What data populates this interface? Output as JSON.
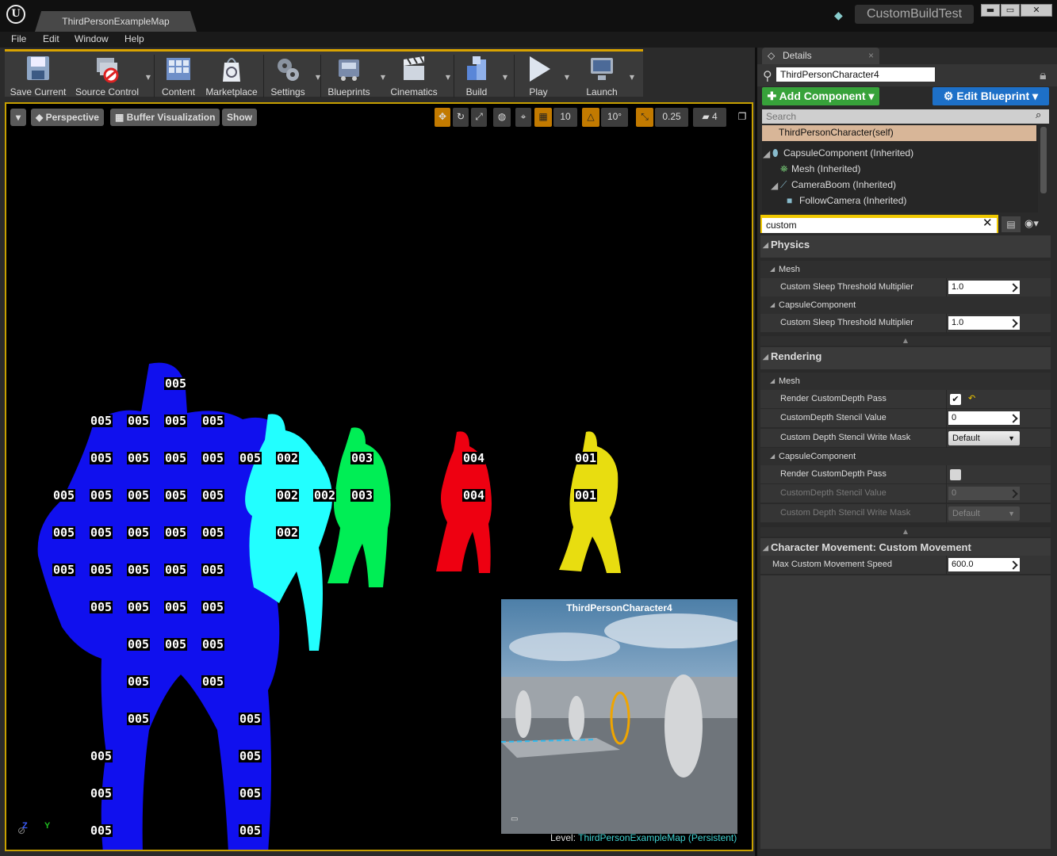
{
  "window": {
    "tab_title": "ThirdPersonExampleMap",
    "project_name": "CustomBuildTest",
    "minimize": "▬",
    "maximize": "▭",
    "close": "✕"
  },
  "menu": [
    "File",
    "Edit",
    "Window",
    "Help"
  ],
  "toolbar": {
    "save": "Save Current",
    "source_control": "Source Control",
    "content": "Content",
    "marketplace": "Marketplace",
    "settings": "Settings",
    "blueprints": "Blueprints",
    "cinematics": "Cinematics",
    "build": "Build",
    "play": "Play",
    "launch": "Launch"
  },
  "viewport": {
    "perspective": "Perspective",
    "buffer_visualization": "Buffer Visualization",
    "show": "Show",
    "grid_snap": "10",
    "rotation_snap": "10°",
    "scale_snap": "0.25",
    "camera_speed": "4",
    "stencil_labels": [
      "005",
      "002",
      "003",
      "004",
      "001"
    ],
    "pip_title": "ThirdPersonCharacter4",
    "level_label": "Level:",
    "level_name": "ThirdPersonExampleMap",
    "level_suffix": "(Persistent)",
    "axis_z": "Z",
    "axis_y": "Y"
  },
  "details": {
    "tab_label": "Details",
    "actor_name": "ThirdPersonCharacter4",
    "add_component": "Add Component",
    "edit_blueprint": "Edit Blueprint",
    "component_search_placeholder": "Search",
    "components": [
      "ThirdPersonCharacter(self)",
      "CapsuleComponent (Inherited)",
      "Mesh (Inherited)",
      "CameraBoom (Inherited)",
      "FollowCamera (Inherited)"
    ],
    "filter_value": "custom",
    "categories": {
      "physics": "Physics",
      "rendering": "Rendering",
      "movement": "Character Movement: Custom Movement"
    },
    "subs": {
      "mesh": "Mesh",
      "capsule": "CapsuleComponent"
    },
    "props": {
      "sleep_mult": "Custom Sleep Threshold Multiplier",
      "render_cd": "Render CustomDepth Pass",
      "stencil_value": "CustomDepth Stencil Value",
      "stencil_mask": "Custom Depth Stencil Write Mask",
      "max_speed": "Max Custom Movement Speed"
    },
    "values": {
      "mesh_sleep": "1.0",
      "capsule_sleep": "1.0",
      "mesh_render_cd": true,
      "mesh_stencil_value": "0",
      "mesh_stencil_mask": "Default",
      "capsule_render_cd": false,
      "capsule_stencil_value": "0",
      "capsule_stencil_mask": "Default",
      "max_speed": "600.0"
    }
  },
  "colors": {
    "accent_yellow": "#c7a000",
    "stencil_005": "#1010ee",
    "stencil_002": "#22ffff",
    "stencil_003": "#00ee55",
    "stencil_004": "#ee0011",
    "stencil_001": "#e8dd10",
    "add_component": "#37a23a",
    "edit_blueprint": "#1d70c8"
  }
}
